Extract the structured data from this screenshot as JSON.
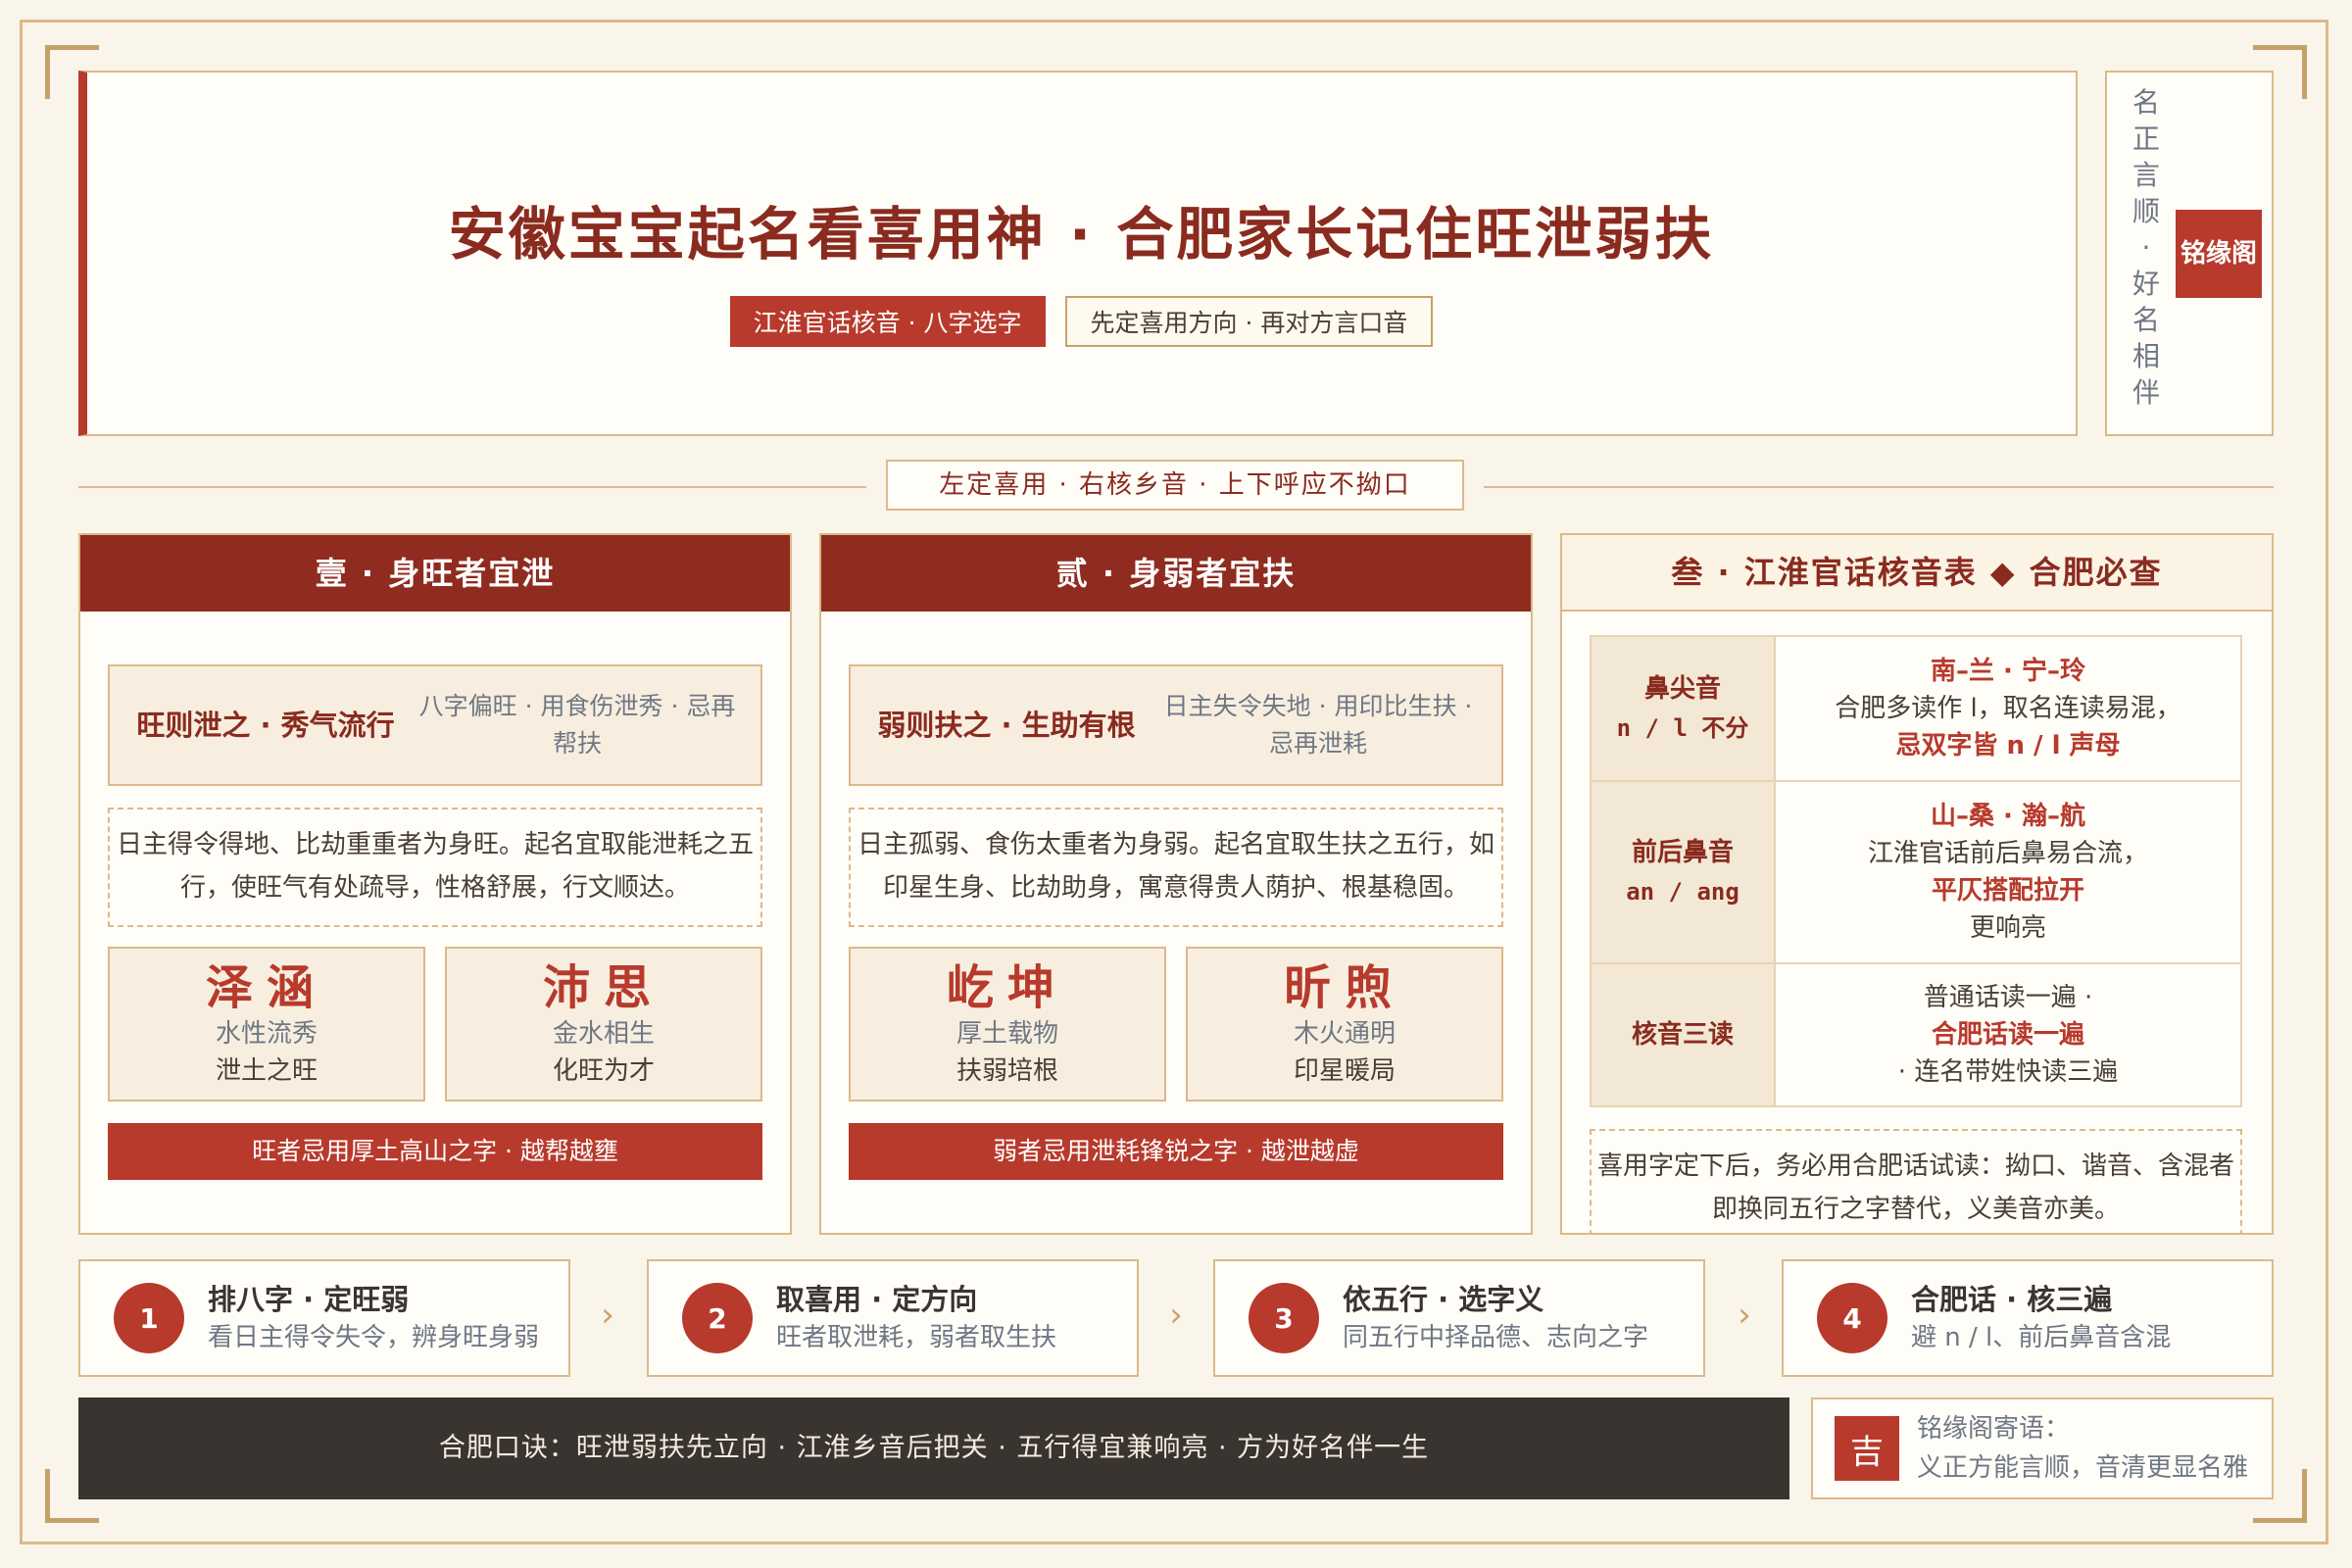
{
  "header": {
    "title": "安徽宝宝起名看喜用神 · 合肥家长记住旺泄弱扶",
    "tag1": "江淮官话核音 · 八字选字",
    "tag2": "先定喜用方向 · 再对方言口音"
  },
  "seal": {
    "vertical_text": "名正言顺 · 好名相伴",
    "stamp": "铭缘阁"
  },
  "motto": "左定喜用 · 右核乡音 · 上下呼应不拗口",
  "panel1": {
    "title": "壹 · 身旺者宜泄",
    "sub_title": "旺则泄之 · 秀气流行",
    "sub_note": "八字偏旺 · 用食伤泄秀 · 忌再帮扶",
    "desc": "日主得令得地、比劫重重者为身旺。起名宜取能泄耗之五行，使旺气有处疏导，性格舒展，行文顺达。",
    "names": [
      {
        "name": "泽涵",
        "line1": "水性流秀",
        "line2": "泄土之旺"
      },
      {
        "name": "沛思",
        "line1": "金水相生",
        "line2": "化旺为才"
      }
    ],
    "warning": "旺者忌用厚土高山之字 · 越帮越壅"
  },
  "panel2": {
    "title": "贰 · 身弱者宜扶",
    "sub_title": "弱则扶之 · 生助有根",
    "sub_note": "日主失令失地 · 用印比生扶 · 忌再泄耗",
    "desc": "日主孤弱、食伤太重者为身弱。起名宜取生扶之五行，如印星生身、比劫助身，寓意得贵人荫护、根基稳固。",
    "names": [
      {
        "name": "屹坤",
        "line1": "厚土载物",
        "line2": "扶弱培根"
      },
      {
        "name": "昕煦",
        "line1": "木火通明",
        "line2": "印星暖局"
      }
    ],
    "warning": "弱者忌用泄耗锋锐之字 · 越泄越虚"
  },
  "panel3": {
    "title": "叁 · 江淮官话核音表 ◆ 合肥必查",
    "rows": [
      {
        "label": "鼻尖音",
        "label2": "n / l 不分",
        "l1": "南–兰 · 宁–玲",
        "l2": "合肥多读作 l，取名连读易混，",
        "l3": "忌双字皆 n / l 声母"
      },
      {
        "label": "前后鼻音",
        "label2": "an / ang",
        "l1": "山–桑 · 瀚–航",
        "l2": "江淮官话前后鼻易合流，",
        "l3": "平仄搭配拉开",
        "l4": "更响亮"
      },
      {
        "label": "核音三读",
        "l1": "普通话读一遍 ·",
        "l2": "合肥话读一遍",
        "l3": "· 连名带姓快读三遍"
      }
    ],
    "note": "喜用字定下后，务必用合肥话试读：拗口、谐音、含混者即换同五行之字替代，义美音亦美。"
  },
  "steps": [
    {
      "num": "1",
      "title": "排八字 · 定旺弱",
      "desc": "看日主得令失令，辨身旺身弱"
    },
    {
      "num": "2",
      "title": "取喜用 · 定方向",
      "desc": "旺者取泄耗，弱者取生扶"
    },
    {
      "num": "3",
      "title": "依五行 · 选字义",
      "desc": "同五行中择品德、志向之字"
    },
    {
      "num": "4",
      "title": "合肥话 · 核三遍",
      "desc": "避 n / l、前后鼻音含混"
    }
  ],
  "chevron": "›",
  "footer": "合肥口诀：旺泄弱扶先立向 · 江淮乡音后把关 · 五行得宜兼响亮 · 方为好名伴一生",
  "blessing": {
    "icon": "吉",
    "line1": "铭缘阁寄语：",
    "line2": "义正方能言顺，音清更显名雅"
  }
}
